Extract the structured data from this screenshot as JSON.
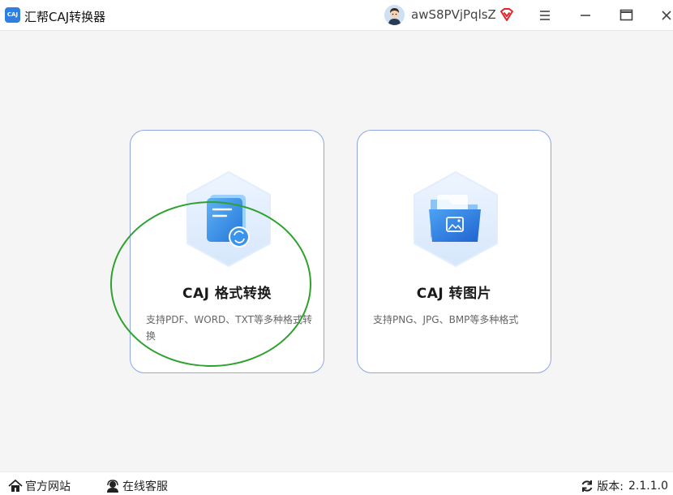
{
  "app": {
    "logo_text": "CAJ",
    "title": "汇帮CAJ转换器"
  },
  "user": {
    "name": "awS8PVjPqlsZ"
  },
  "cards": [
    {
      "title": "CAJ 格式转换",
      "desc": "支持PDF、WORD、TXT等多种格式转换"
    },
    {
      "title": "CAJ 转图片",
      "desc": "支持PNG、JPG、BMP等多种格式"
    }
  ],
  "footer": {
    "website": "官方网站",
    "support": "在线客服",
    "version_label": "版本:",
    "version": "2.1.1.0"
  },
  "colors": {
    "accent": "#2f7fe0",
    "card_border": "#8ea6e6",
    "annotation": "#2ea12e",
    "vip": "#e0242b"
  }
}
